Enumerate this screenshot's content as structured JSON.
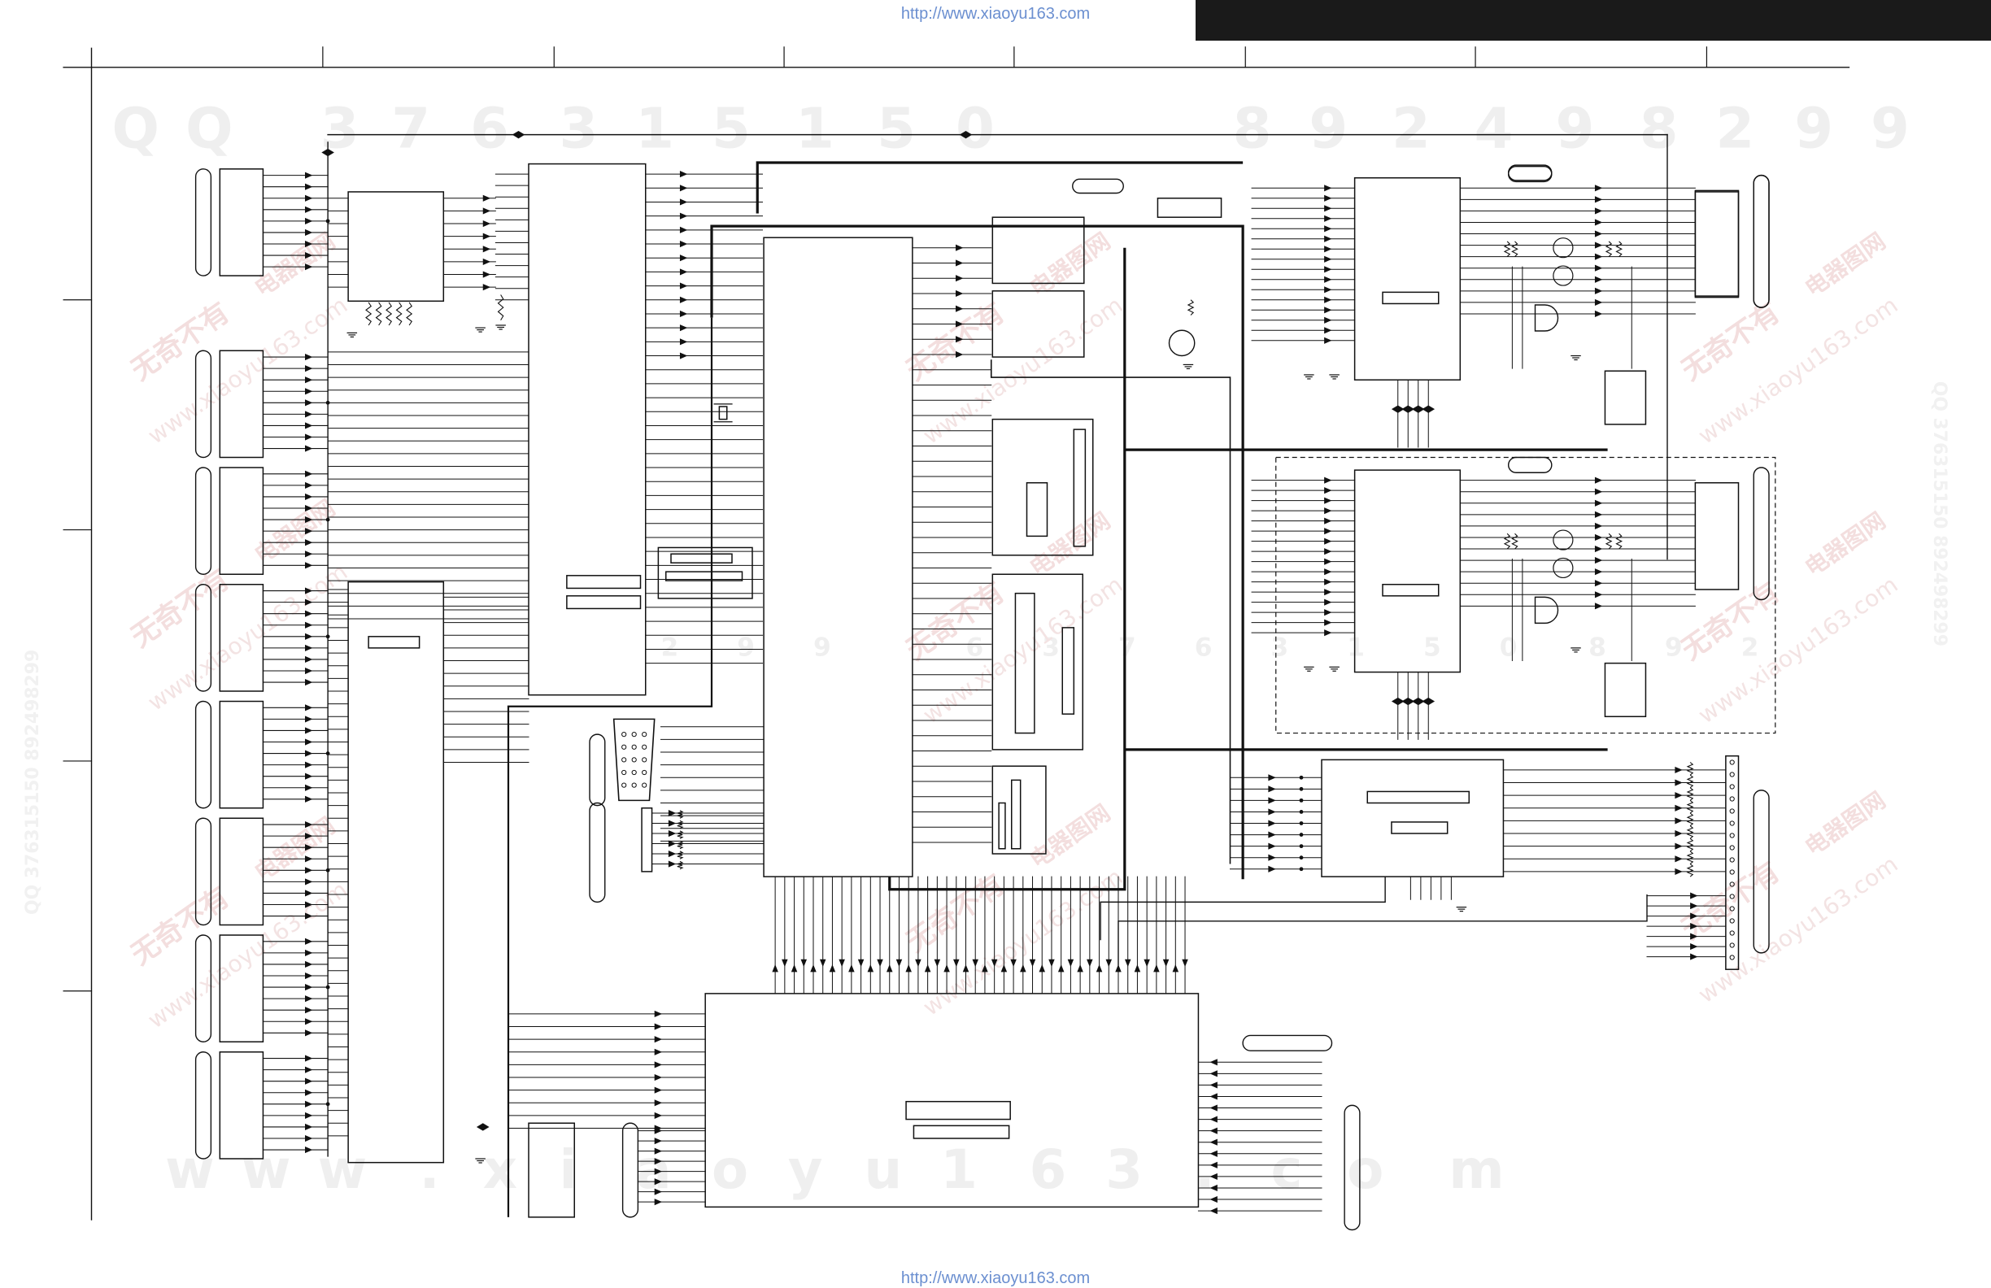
{
  "header": {
    "url_top": "http://www.xiaoyu163.com",
    "url_bottom": "http://www.xiaoyu163.com"
  },
  "watermark": {
    "row_top": [
      "Q",
      "Q",
      "3",
      "7",
      "6",
      "3",
      "1",
      "5",
      "1",
      "5",
      "0",
      "8",
      "9",
      "2",
      "4",
      "9",
      "8",
      "2",
      "9",
      "9"
    ],
    "row_mid": [
      "2",
      "9",
      "9",
      "6",
      "3",
      "7",
      "6",
      "3",
      "1",
      "5",
      "0",
      "8",
      "9",
      "2"
    ],
    "row_bottom": [
      "w",
      "w",
      "w",
      ".",
      "x",
      "i",
      "a",
      "o",
      "y",
      "u",
      "1",
      "6",
      "3",
      ".",
      "c",
      "o",
      "m"
    ],
    "site_cn": "无奇不有",
    "brand_cn": "电器图网",
    "site_en": "www.xiaoyu163.com",
    "side_left": "QQ 376315150 892498299",
    "side_right": "QQ 376315150 892498299"
  }
}
